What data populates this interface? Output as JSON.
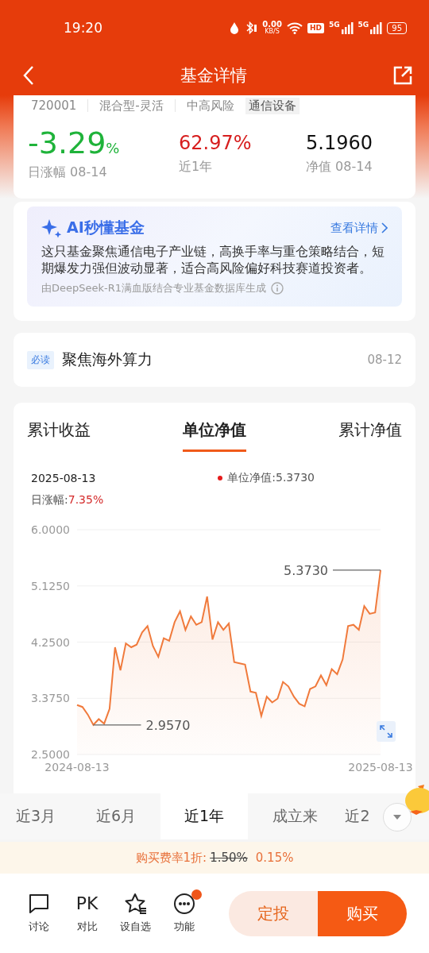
{
  "status_bar": {
    "time": "19:20",
    "speed_value": "0.00",
    "speed_unit": "KB/S",
    "hd": "HD",
    "networks": [
      "5G",
      "5G"
    ],
    "battery": "95"
  },
  "nav": {
    "title": "基金详情"
  },
  "fund": {
    "code": "720001",
    "tags": [
      {
        "label": "混合型-灵活",
        "kind": "plain"
      },
      {
        "label": "中高风险",
        "kind": "plain"
      },
      {
        "label": "通信设备",
        "kind": "chip"
      }
    ],
    "stats": [
      {
        "value": "-3.29",
        "unit": "%",
        "label": "日涨幅 08-14",
        "color": "#1fb33a",
        "kind": "big"
      },
      {
        "value": "62.97%",
        "label": "近1年",
        "color": "#d71e1e",
        "kind": "normal"
      },
      {
        "value": "5.1960",
        "label": "净值 08-14",
        "color": "#111111",
        "kind": "normal"
      }
    ]
  },
  "ai": {
    "title": "AI秒懂基金",
    "link": "查看详情",
    "summary": "这只基金聚焦通信电子产业链，高换手率与重仓策略结合，短期爆发力强但波动显著，适合高风险偏好科技赛道投资者。",
    "source": "由DeepSeek-R1满血版结合专业基金数据库生成"
  },
  "news": {
    "badge": "必读",
    "title": "聚焦海外算力",
    "date": "08-12"
  },
  "chart_tabs": [
    {
      "label": "累计收益",
      "selected": false
    },
    {
      "label": "单位净值",
      "selected": true
    },
    {
      "label": "累计净值",
      "selected": false
    }
  ],
  "chart_info": {
    "date": "2025-08-13",
    "series_label": "单位净值:5.3730",
    "change_label": "日涨幅:",
    "change_value": "7.35%"
  },
  "chart": {
    "chart_data": {
      "type": "area",
      "ylim": [
        2.5,
        6.0
      ],
      "yticks": [
        {
          "value": 6.0,
          "label": "6.0000"
        },
        {
          "value": 5.125,
          "label": "5.1250"
        },
        {
          "value": 4.25,
          "label": "4.2500"
        },
        {
          "value": 3.375,
          "label": "3.3750"
        },
        {
          "value": 2.5,
          "label": "2.5000"
        }
      ],
      "categories": [
        "2024-08-13",
        null,
        null,
        null,
        null,
        null,
        null,
        null,
        null,
        null,
        null,
        null,
        null,
        null,
        null,
        null,
        null,
        null,
        null,
        null,
        null,
        null,
        null,
        null,
        null,
        null,
        null,
        null,
        null,
        null,
        null,
        null,
        null,
        null,
        null,
        null,
        null,
        null,
        null,
        null,
        null,
        null,
        null,
        null,
        null,
        null,
        null,
        null,
        null,
        null,
        null,
        null,
        null,
        null,
        null,
        null,
        "2025-08-13"
      ],
      "series": [
        {
          "color": "#f07a3c",
          "values": [
            3.27,
            3.24,
            3.12,
            2.96,
            3.05,
            2.98,
            3.21,
            4.17,
            3.81,
            4.23,
            4.17,
            4.21,
            4.4,
            4.5,
            4.19,
            4.02,
            4.31,
            4.27,
            4.56,
            4.73,
            4.44,
            4.65,
            4.52,
            4.56,
            4.96,
            4.29,
            4.56,
            4.44,
            4.54,
            3.94,
            3.92,
            3.9,
            3.48,
            3.46,
            3.1,
            3.4,
            3.31,
            3.37,
            3.63,
            3.56,
            3.4,
            3.29,
            3.25,
            3.52,
            3.56,
            3.73,
            3.58,
            3.83,
            3.75,
            3.98,
            4.5,
            4.52,
            4.44,
            4.81,
            4.69,
            4.71,
            5.37
          ]
        }
      ],
      "grid": true,
      "annotations": [
        "2.9570",
        "5.3730"
      ]
    }
  },
  "ranges": [
    {
      "label": "近3月",
      "selected": false
    },
    {
      "label": "近6月",
      "selected": false
    },
    {
      "label": "近1年",
      "selected": true
    },
    {
      "label": "成立来",
      "selected": false
    },
    {
      "label": "近2",
      "selected": false
    }
  ],
  "fee": {
    "label": "购买费率1折:",
    "old": "1.50%",
    "new": "0.15%"
  },
  "bottom_bar": {
    "items": [
      {
        "label": "讨论",
        "badge": false
      },
      {
        "glyph": "PK",
        "label": "对比",
        "badge": false
      },
      {
        "label": "设自选",
        "badge": false
      },
      {
        "label": "功能",
        "badge": true
      }
    ],
    "buttons": [
      {
        "label": "定投",
        "kind": "secondary"
      },
      {
        "label": "购买",
        "kind": "primary"
      }
    ]
  }
}
